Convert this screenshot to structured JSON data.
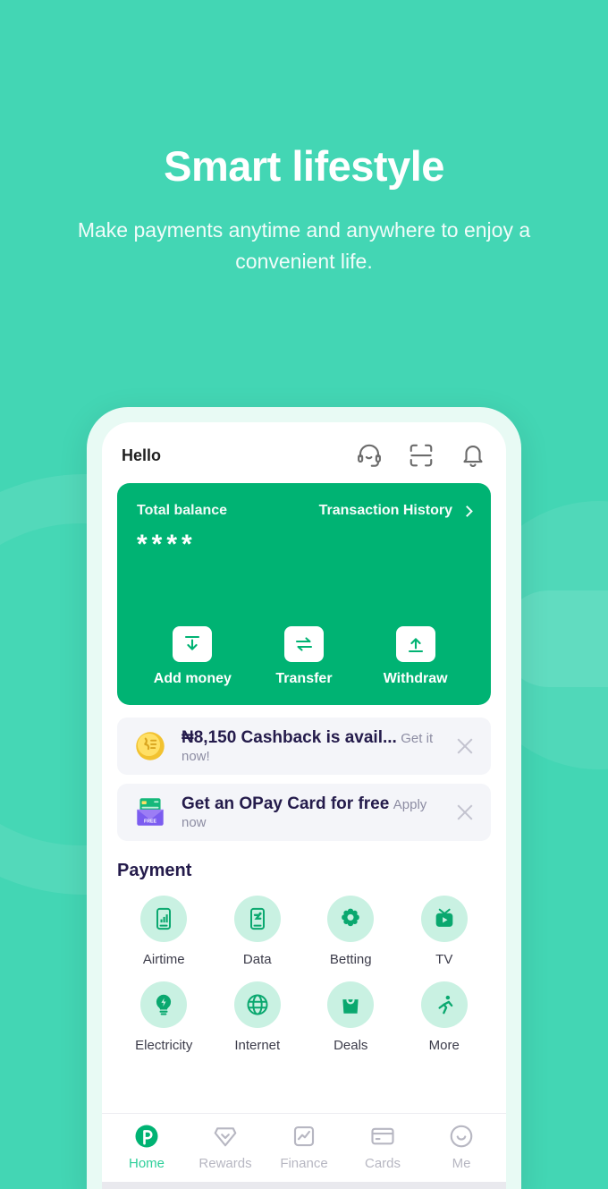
{
  "theme": {
    "background": "#43d6b4",
    "card_green": "#00b373",
    "accent_mint": "#c9f1e2",
    "navy": "#241b4b",
    "active_nav": "#2ecf9a"
  },
  "hero": {
    "title": "Smart lifestyle",
    "subtitle": "Make payments anytime and anywhere to enjoy a convenient life."
  },
  "app": {
    "header": {
      "greeting": "Hello",
      "icons": [
        {
          "name": "support-headset-icon"
        },
        {
          "name": "scan-qr-icon"
        },
        {
          "name": "notification-bell-icon"
        }
      ]
    },
    "balance_card": {
      "label": "Total balance",
      "history_link": "Transaction History",
      "amount": "****",
      "actions": [
        {
          "label": "Add money",
          "icon": "download-arrow-icon"
        },
        {
          "label": "Transfer",
          "icon": "transfer-arrows-icon"
        },
        {
          "label": "Withdraw",
          "icon": "upload-arrow-icon"
        }
      ]
    },
    "promos": [
      {
        "icon": "gold-coin-icon",
        "title": "₦8,150 Cashback is avail...",
        "subtitle": "Get it now!",
        "close": "close-icon"
      },
      {
        "icon": "card-envelope-icon",
        "title": "Get an OPay Card for free",
        "subtitle": "Apply now",
        "close": "close-icon"
      }
    ],
    "payment": {
      "title": "Payment",
      "tiles": [
        {
          "label": "Airtime",
          "icon": "airtime-phone-icon"
        },
        {
          "label": "Data",
          "icon": "data-phone-icon"
        },
        {
          "label": "Betting",
          "icon": "betting-icon"
        },
        {
          "label": "TV",
          "icon": "tv-icon"
        },
        {
          "label": "Electricity",
          "icon": "electricity-bulb-icon"
        },
        {
          "label": "Internet",
          "icon": "internet-globe-icon"
        },
        {
          "label": "Deals",
          "icon": "deals-bag-icon"
        },
        {
          "label": "More",
          "icon": "more-running-icon"
        }
      ]
    },
    "bottom_nav": [
      {
        "label": "Home",
        "icon": "opay-logo-icon",
        "active": true
      },
      {
        "label": "Rewards",
        "icon": "diamond-icon",
        "active": false
      },
      {
        "label": "Finance",
        "icon": "chart-icon",
        "active": false
      },
      {
        "label": "Cards",
        "icon": "credit-card-icon",
        "active": false
      },
      {
        "label": "Me",
        "icon": "smiley-face-icon",
        "active": false
      }
    ]
  }
}
